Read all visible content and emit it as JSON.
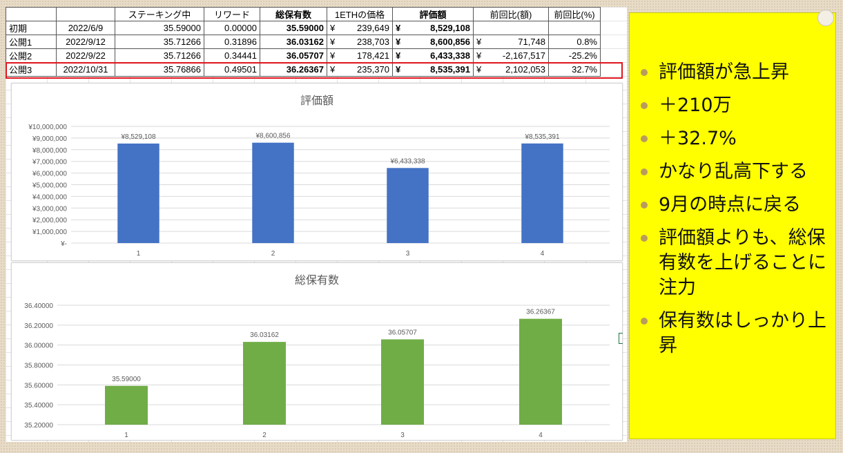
{
  "table": {
    "headers": [
      "",
      "",
      "ステーキング中",
      "リワード",
      "総保有数",
      "1ETHの価格",
      "評価額",
      "前回比(額)",
      "前回比(%)"
    ],
    "rows": [
      {
        "label": "初期",
        "date": "2022/6/9",
        "staking": "35.59000",
        "reward": "0.00000",
        "total": "35.59000",
        "price": "239,649",
        "value": "8,529,108",
        "diff": "",
        "pct": ""
      },
      {
        "label": "公開1",
        "date": "2022/9/12",
        "staking": "35.71266",
        "reward": "0.31896",
        "total": "36.03162",
        "price": "238,703",
        "value": "8,600,856",
        "diff": "71,748",
        "pct": "0.8%"
      },
      {
        "label": "公開2",
        "date": "2022/9/22",
        "staking": "35.71266",
        "reward": "0.34441",
        "total": "36.05707",
        "price": "178,421",
        "value": "6,433,338",
        "diff": "-2,167,517",
        "pct": "-25.2%"
      },
      {
        "label": "公開3",
        "date": "2022/10/31",
        "staking": "35.76866",
        "reward": "0.49501",
        "total": "36.26367",
        "price": "235,370",
        "value": "8,535,391",
        "diff": "2,102,053",
        "pct": "32.7%"
      }
    ],
    "yen": "¥"
  },
  "chart_data": [
    {
      "type": "bar",
      "title": "評価額",
      "categories": [
        "1",
        "2",
        "3",
        "4"
      ],
      "values": [
        8529108,
        8600856,
        6433338,
        8535391
      ],
      "data_labels": [
        "¥8,529,108",
        "¥8,600,856",
        "¥6,433,338",
        "¥8,535,391"
      ],
      "ylim": [
        0,
        10000000
      ],
      "ytick_labels": [
        "¥-",
        "¥1,000,000",
        "¥2,000,000",
        "¥3,000,000",
        "¥4,000,000",
        "¥5,000,000",
        "¥6,000,000",
        "¥7,000,000",
        "¥8,000,000",
        "¥9,000,000",
        "¥10,000,000"
      ],
      "color": "#4472c4",
      "grid": true
    },
    {
      "type": "bar",
      "title": "総保有数",
      "categories": [
        "1",
        "2",
        "3",
        "4"
      ],
      "values": [
        35.59,
        36.03162,
        36.05707,
        36.26367
      ],
      "data_labels": [
        "35.59000",
        "36.03162",
        "36.05707",
        "36.26367"
      ],
      "ylim": [
        35.2,
        36.4
      ],
      "ytick_labels": [
        "35.20000",
        "35.40000",
        "35.60000",
        "35.80000",
        "36.00000",
        "36.20000",
        "36.40000"
      ],
      "color": "#70ad47",
      "grid": true
    }
  ],
  "notes": [
    "評価額が急上昇",
    "＋210万",
    "＋32.7%",
    "かなり乱高下する",
    "9月の時点に戻る",
    "評価額よりも、総保有数を上げることに注力",
    "保有数はしっかり上昇"
  ],
  "colors": {
    "panel": "#ffff00",
    "highlight": "#e0141c",
    "bar1": "#4472c4",
    "bar2": "#70ad47"
  }
}
